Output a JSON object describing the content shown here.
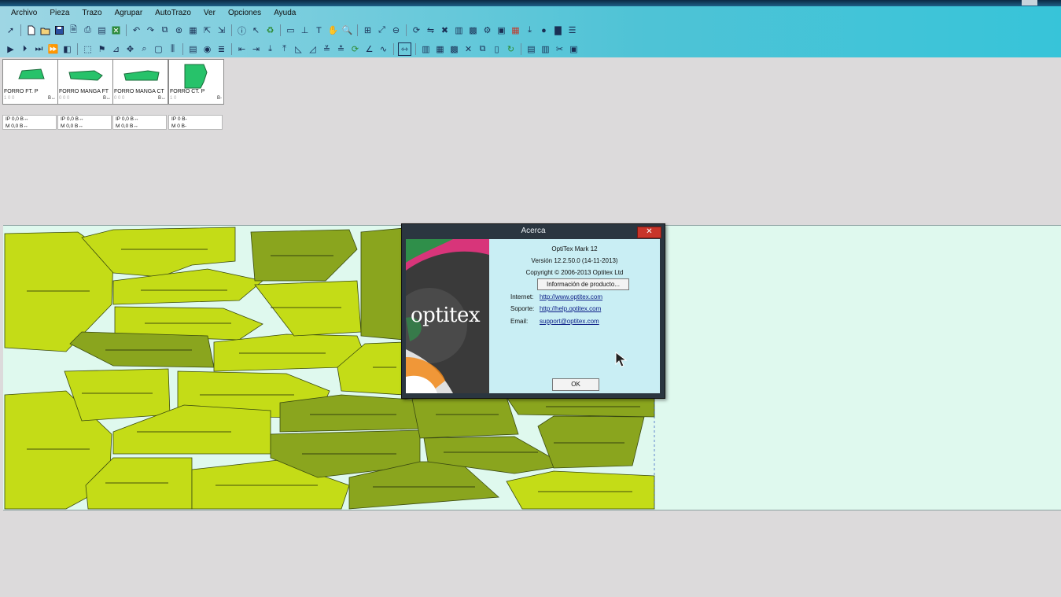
{
  "menu": [
    "Archivo",
    "Pieza",
    "Trazo",
    "Agrupar",
    "AutoTrazo",
    "Ver",
    "Opciones",
    "Ayuda"
  ],
  "pieces": [
    {
      "name": "FORRO FT. P",
      "qty": "1 0 0",
      "badge": "B↔"
    },
    {
      "name": "FORRO MANGA FT",
      "qty": "0 0 0",
      "badge": "B↔"
    },
    {
      "name": "FORRO MANGA CT",
      "qty": "0 0 0",
      "badge": "B↔"
    },
    {
      "name": "FORRO CT. P",
      "qty": "1 0",
      "badge": "B-"
    }
  ],
  "piece_params": [
    {
      "ip": "IP  0,0 B↔",
      "m": "M  0,0 B↔"
    },
    {
      "ip": "IP  0,0 B↔",
      "m": "M  0,0 B↔"
    },
    {
      "ip": "IP  0,0 B↔",
      "m": "M  0,0 B↔"
    },
    {
      "ip": "IP  0  B-",
      "m": "M  0  B-"
    }
  ],
  "dialog": {
    "title": "Acerca",
    "close_label": "✕",
    "logo_text": "optitex",
    "product": "OptiTex Mark 12",
    "version": "Versión 12.2.50.0 (14-11-2013)",
    "copyright": "Copyright © 2006-2013 Optitex Ltd",
    "info_button": "Información de producto...",
    "internet_label": "Internet:",
    "internet_url": "http://www.optitex.com",
    "support_label": "Soporte:",
    "support_url": "http://help.optitex.com",
    "email_label": "Email:",
    "email": "support@optitex.com",
    "ok_label": "OK"
  },
  "colors": {
    "light_piece": "#c4dc17",
    "dark_piece": "#8aa51e",
    "canvas_bg": "#dff9ee",
    "ribbon": "#4fc3d6"
  }
}
